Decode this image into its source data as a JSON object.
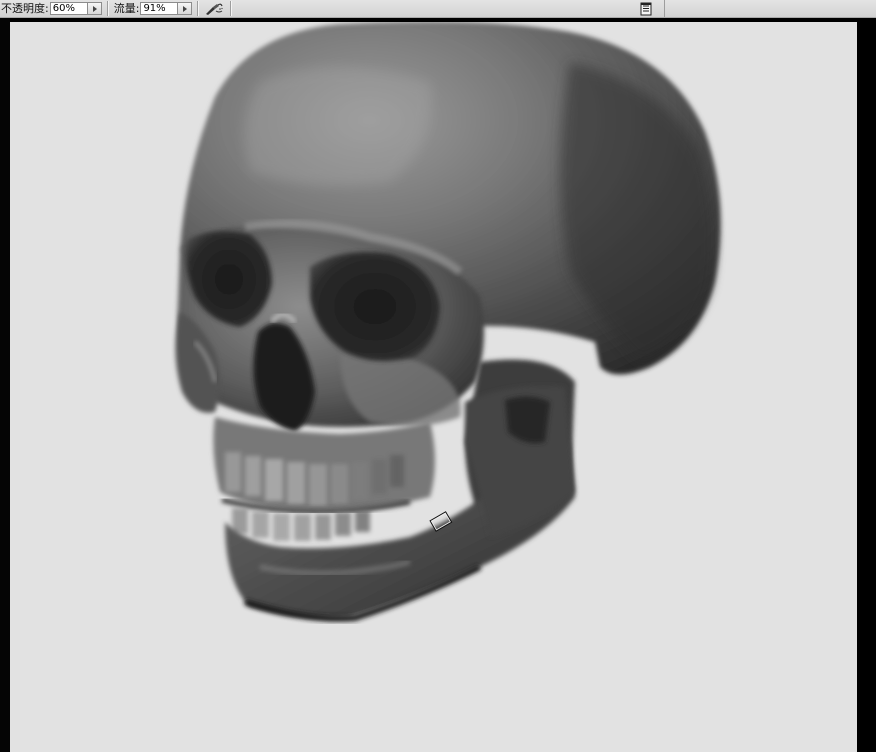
{
  "options_bar": {
    "opacity": {
      "label": "不透明度:",
      "value": "60%"
    },
    "flow": {
      "label": "流量:",
      "value": "91%"
    },
    "icons": {
      "airbrush": "airbrush-icon",
      "brush_panel_toggle": "brush-panel-toggle-icon",
      "value_dropdown": "triangle-right-icon"
    }
  },
  "canvas": {
    "background_color": "#e2e2e2",
    "subject": "painted-skull-artwork",
    "cursor": "brush-cursor-icon"
  }
}
